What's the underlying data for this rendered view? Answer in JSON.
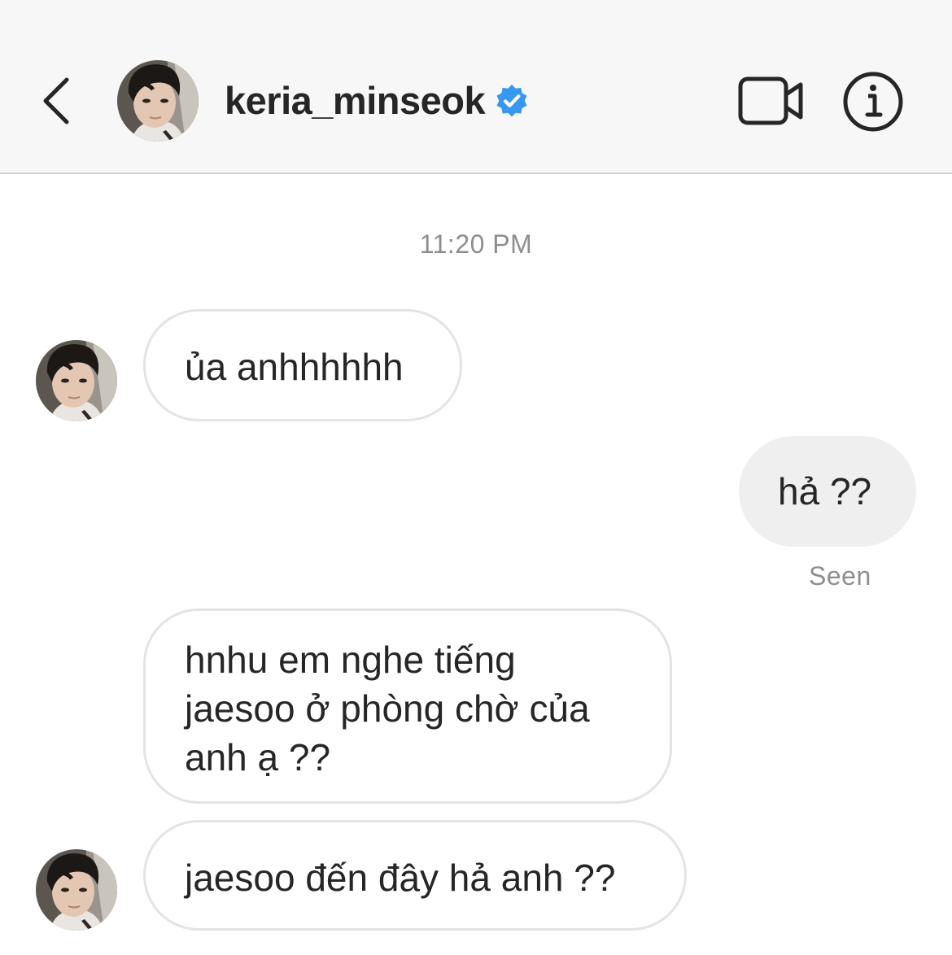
{
  "header": {
    "username": "keria_minseok",
    "verified": true,
    "icons": {
      "back": "chevron-left-icon",
      "video_call": "video-camera-icon",
      "info": "info-circle-icon",
      "verified": "verified-badge-icon"
    }
  },
  "thread": {
    "timestamp": "11:20 PM",
    "messages": [
      {
        "direction": "incoming",
        "text": "ủa anhhhhhh",
        "show_avatar": true
      },
      {
        "direction": "outgoing",
        "text": "hả ??"
      },
      {
        "direction": "incoming",
        "text": "hnhu em nghe tiếng jaesoo ở phòng chờ của anh ạ ??",
        "show_avatar": false
      },
      {
        "direction": "incoming",
        "text": "jaesoo đến đây hả anh ??",
        "show_avatar": true
      }
    ],
    "seen_label": "Seen"
  },
  "colors": {
    "header_bg": "#f7f7f7",
    "incoming_border": "#e4e4e4",
    "outgoing_bubble": "#efefef",
    "meta_text": "#8e8e8e",
    "verified_blue": "#3897f0"
  }
}
